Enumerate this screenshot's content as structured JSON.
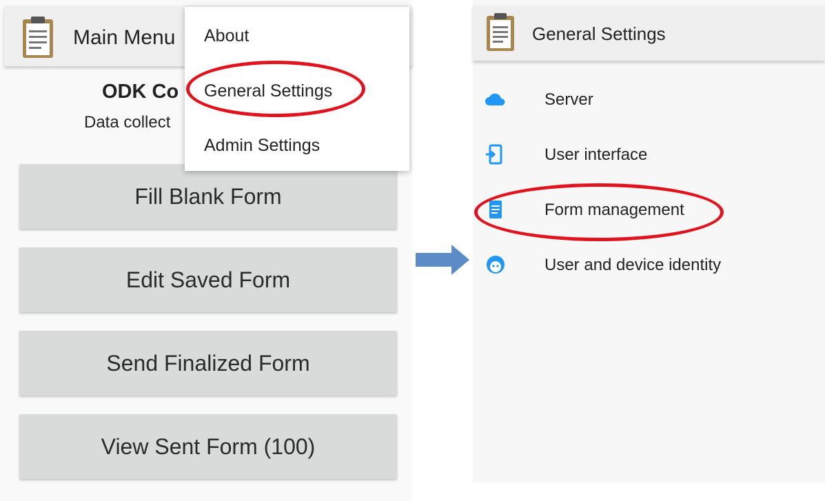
{
  "left": {
    "toolbar_title": "Main Menu",
    "app_name": "ODK Co",
    "app_subtitle": "Data collect",
    "buttons": [
      "Fill Blank Form",
      "Edit Saved Form",
      "Send Finalized Form",
      "View Sent Form (100)"
    ],
    "overflow_menu": [
      "About",
      "General Settings",
      "Admin Settings"
    ]
  },
  "right": {
    "toolbar_title": "General Settings",
    "items": [
      {
        "label": "Server",
        "icon": "cloud-icon"
      },
      {
        "label": "User interface",
        "icon": "user-interface-icon"
      },
      {
        "label": "Form management",
        "icon": "form-management-icon"
      },
      {
        "label": "User and device identity",
        "icon": "identity-face-icon"
      }
    ]
  },
  "colors": {
    "accent": "#2196f3",
    "highlight": "#e0141e",
    "arrow": "#5b8cc8",
    "button_bg": "#d9dbdb",
    "toolbar_bg": "#efefef"
  }
}
